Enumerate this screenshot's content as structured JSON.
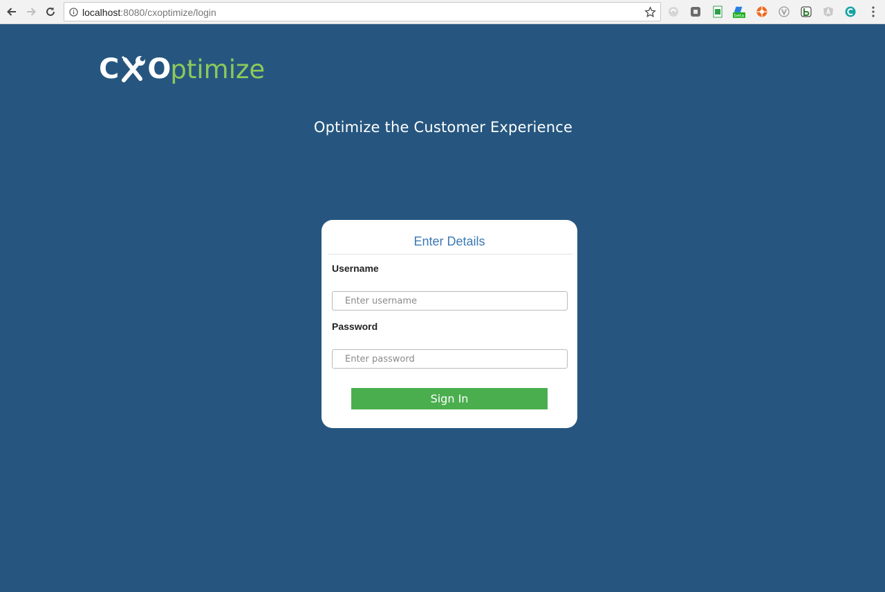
{
  "browser": {
    "url_host": "localhost",
    "url_path": ":8080/cxoptimize/login",
    "extensions": [
      {
        "name": "disabled-extension-icon",
        "color": "#c8c8c8"
      },
      {
        "name": "grey-extension-icon",
        "color": "#6b6b6b"
      },
      {
        "name": "sheets-extension-icon",
        "color": "#2e9e4a"
      },
      {
        "name": "beta-extension-icon",
        "color": "#2a7de1",
        "badge": "beta"
      },
      {
        "name": "orange-extension-icon",
        "color": "#ee6a1f"
      },
      {
        "name": "v-extension-icon",
        "color": "#999999",
        "text": "V"
      },
      {
        "name": "b-extension-icon",
        "color": "#2e7d32",
        "text": "B"
      },
      {
        "name": "angular-extension-icon",
        "color": "#b9b9b9",
        "text": "A"
      },
      {
        "name": "teal-extension-icon",
        "color": "#1aa3a3"
      }
    ]
  },
  "page": {
    "logo_bold": "CXO",
    "logo_rest": "ptimize",
    "tagline": "Optimize the Customer Experience"
  },
  "login": {
    "title": "Enter Details",
    "username_label": "Username",
    "username_placeholder": "Enter username",
    "password_label": "Password",
    "password_placeholder": "Enter password",
    "submit_label": "Sign In"
  },
  "colors": {
    "background": "#26567f",
    "accent_green": "#4aae4e",
    "logo_green": "#8dc95a",
    "title_blue": "#3a78b5"
  }
}
